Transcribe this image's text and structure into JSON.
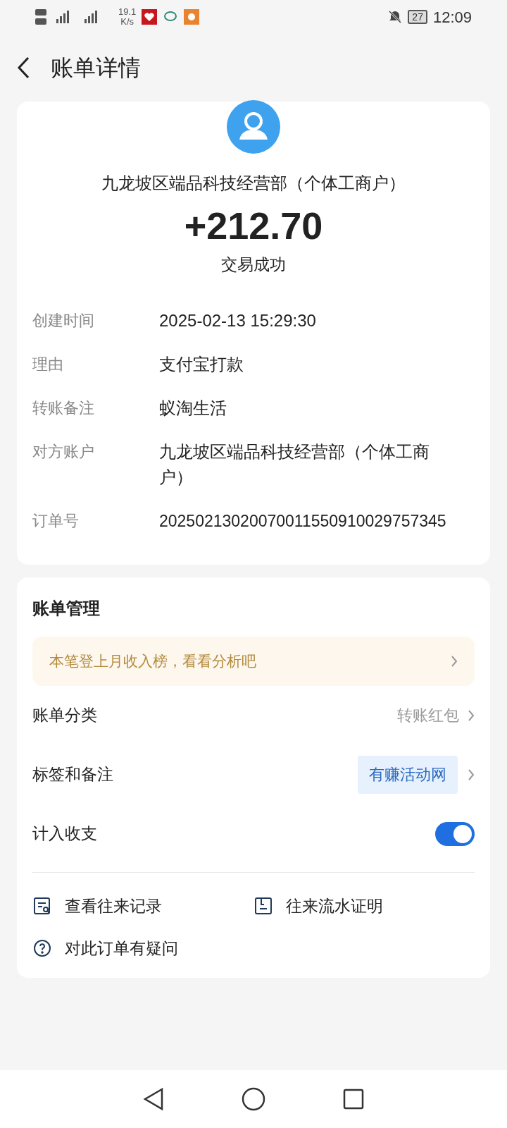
{
  "status_bar": {
    "speed": "19.1",
    "speed_unit": "K/s",
    "battery": "27",
    "time": "12:09"
  },
  "header": {
    "title": "账单详情"
  },
  "summary": {
    "counterparty": "九龙坡区端品科技经营部（个体工商户）",
    "amount": "+212.70",
    "status": "交易成功"
  },
  "details": [
    {
      "label": "创建时间",
      "value": "2025-02-13 15:29:30",
      "kind": "text"
    },
    {
      "label": "理由",
      "value": "支付宝打款",
      "kind": "text"
    },
    {
      "label": "转账备注",
      "value": "蚁淘生活",
      "kind": "text"
    },
    {
      "label": "对方账户",
      "value": "九龙坡区端品科技经营部（个体工商户）",
      "kind": "text"
    },
    {
      "label": "订单号",
      "value": "20250213020070011550910029757345",
      "kind": "number"
    }
  ],
  "management": {
    "title": "账单管理",
    "banner": "本笔登上月收入榜，看看分析吧",
    "rows": [
      {
        "label": "账单分类",
        "value": "转账红包",
        "kind": "link"
      },
      {
        "label": "标签和备注",
        "value": "有赚活动网",
        "kind": "tag"
      },
      {
        "label": "计入收支",
        "kind": "toggle",
        "on": true
      }
    ],
    "actions": [
      {
        "label": "查看往来记录",
        "kind": "records"
      },
      {
        "label": "往来流水证明",
        "kind": "proof"
      },
      {
        "label": "对此订单有疑问",
        "kind": "question"
      }
    ]
  }
}
